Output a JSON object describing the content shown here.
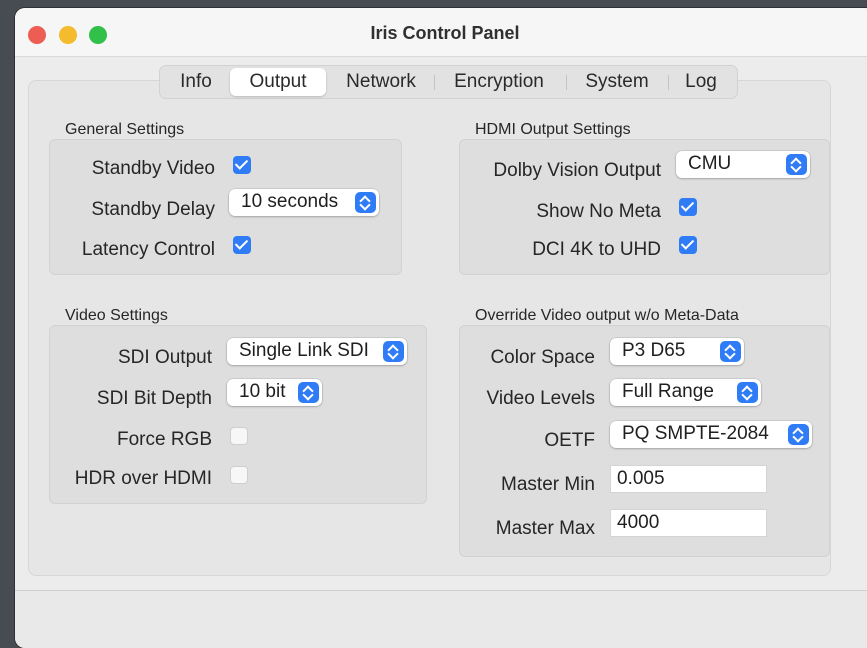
{
  "window": {
    "title": "Iris Control Panel"
  },
  "tabs": [
    {
      "label": "Info"
    },
    {
      "label": "Output"
    },
    {
      "label": "Network"
    },
    {
      "label": "Encryption"
    },
    {
      "label": "System"
    },
    {
      "label": "Log"
    }
  ],
  "active_tab": "Output",
  "general": {
    "title": "General Settings",
    "standby_video": {
      "label": "Standby Video",
      "checked": true
    },
    "standby_delay": {
      "label": "Standby Delay",
      "value": "10 seconds"
    },
    "latency_control": {
      "label": "Latency Control",
      "checked": true
    }
  },
  "hdmi": {
    "title": "HDMI Output Settings",
    "dolby_vision": {
      "label": "Dolby Vision Output",
      "value": "CMU"
    },
    "show_no_meta": {
      "label": "Show No Meta",
      "checked": true
    },
    "dci_4k": {
      "label": "DCI 4K to UHD",
      "checked": true
    }
  },
  "video": {
    "title": "Video Settings",
    "sdi_output": {
      "label": "SDI Output",
      "value": "Single Link SDI"
    },
    "sdi_bit_depth": {
      "label": "SDI Bit Depth",
      "value": "10 bit"
    },
    "force_rgb": {
      "label": "Force RGB",
      "checked": false
    },
    "hdr_over_hdmi": {
      "label": "HDR over HDMI",
      "checked": false
    }
  },
  "override": {
    "title": "Override Video output w/o Meta-Data",
    "color_space": {
      "label": "Color Space",
      "value": "P3 D65"
    },
    "video_levels": {
      "label": "Video Levels",
      "value": "Full Range"
    },
    "oetf": {
      "label": "OETF",
      "value": "PQ SMPTE-2084"
    },
    "master_min": {
      "label": "Master Min",
      "value": "0.005"
    },
    "master_max": {
      "label": "Master Max",
      "value": "4000"
    }
  },
  "colors": {
    "accent": "#2f7cf6",
    "close": "#ee5d54",
    "minimize": "#f4bb2d",
    "zoom": "#31c14a"
  }
}
